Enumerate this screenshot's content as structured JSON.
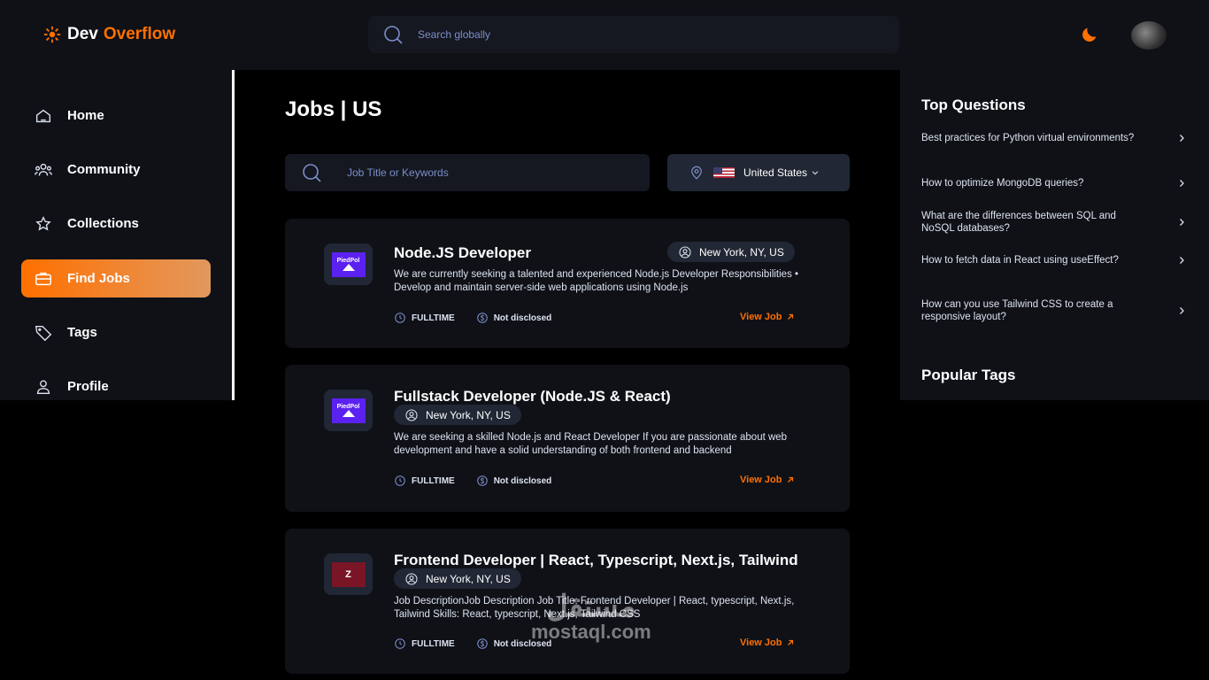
{
  "header": {
    "brand_first": "Dev",
    "brand_second": "Overflow",
    "search_placeholder": "Search globally"
  },
  "sidebar": {
    "items": [
      {
        "label": "Home",
        "icon": "home-icon"
      },
      {
        "label": "Community",
        "icon": "users-icon"
      },
      {
        "label": "Collections",
        "icon": "star-icon"
      },
      {
        "label": "Find Jobs",
        "icon": "briefcase-icon",
        "active": true
      },
      {
        "label": "Tags",
        "icon": "tag-icon"
      },
      {
        "label": "Profile",
        "icon": "user-icon"
      }
    ]
  },
  "main": {
    "title": "Jobs | US",
    "search_placeholder": "Job Title or Keywords",
    "location": "United States",
    "jobs": [
      {
        "title": "Node.JS Developer",
        "logo_text": "PiedPol",
        "location": "New York, NY, US",
        "description": "We are currently seeking a talented and experienced Node.js Developer Responsibilities • Develop and maintain server-side web applications using Node.js",
        "type": "FULLTIME",
        "salary": "Not disclosed",
        "action": "View Job"
      },
      {
        "title": "Fullstack Developer (Node.JS & React)",
        "logo_text": "PiedPol",
        "location": "New York, NY, US",
        "description": "We are seeking a skilled Node.js and React Developer If you are passionate about web development and have a solid understanding of both frontend and backend",
        "type": "FULLTIME",
        "salary": "Not disclosed",
        "action": "View Job"
      },
      {
        "title": "Frontend Developer | React, Typescript, Next.js, Tailwind",
        "logo_text": "Z",
        "location": "New York, NY, US",
        "description": "Job DescriptionJob Description Job Title: Frontend Developer | React, typescript, Next.js, Tailwind Skills: React, typescript, Next.js, Tailwind CSS",
        "type": "FULLTIME",
        "salary": "Not disclosed",
        "action": "View Job"
      }
    ]
  },
  "rightbar": {
    "top_questions_title": "Top Questions",
    "questions": [
      "Best practices for Python virtual environments?",
      "How to optimize MongoDB queries?",
      "What are the differences between SQL and NoSQL databases?",
      "How to fetch data in React using useEffect?",
      "How can you use Tailwind CSS to create a responsive layout?"
    ],
    "popular_tags_title": "Popular Tags"
  },
  "watermark": {
    "arabic": "مستقل",
    "latin": "mostaql.com"
  },
  "colors": {
    "accent": "#ff7000",
    "background": "#000000",
    "panel": "#0f1117",
    "input": "#151821"
  }
}
